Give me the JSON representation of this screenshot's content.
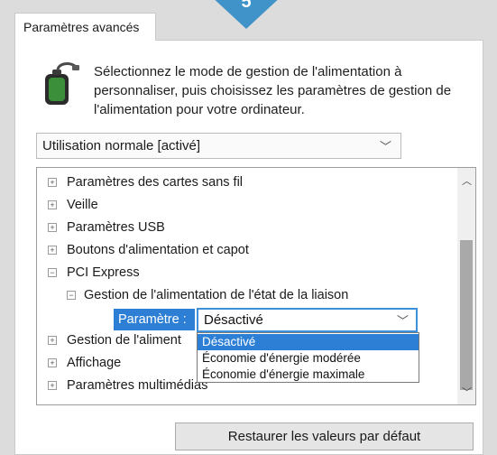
{
  "badge": "5",
  "tab": {
    "label": "Paramètres avancés"
  },
  "description": "Sélectionnez le mode de gestion de l'alimentation à personnaliser, puis choisissez les paramètres de gestion de l'alimentation pour votre ordinateur.",
  "plan_select": {
    "value": "Utilisation normale [activé]"
  },
  "tree": {
    "items": [
      {
        "label": "Paramètres des cartes sans fil",
        "expander": "+"
      },
      {
        "label": "Veille",
        "expander": "+"
      },
      {
        "label": "Paramètres USB",
        "expander": "+"
      },
      {
        "label": "Boutons d'alimentation et capot",
        "expander": "+"
      },
      {
        "label": "PCI Express",
        "expander": "−"
      },
      {
        "label": "Gestion de l'alimentation de l'état de la liaison",
        "expander": "−"
      },
      {
        "label": "Gestion de l'aliment",
        "expander": "+"
      },
      {
        "label": "Affichage",
        "expander": "+"
      },
      {
        "label": "Paramètres multimédias",
        "expander": "+"
      }
    ]
  },
  "param": {
    "label": "Paramètre :",
    "value": "Désactivé",
    "options": [
      "Désactivé",
      "Économie d'énergie modérée",
      "Économie d'énergie maximale"
    ]
  },
  "restore_button": {
    "label": "Restaurer les valeurs par défaut"
  },
  "colors": {
    "accent": "#2d7fd6",
    "badge": "#3f93c8"
  }
}
